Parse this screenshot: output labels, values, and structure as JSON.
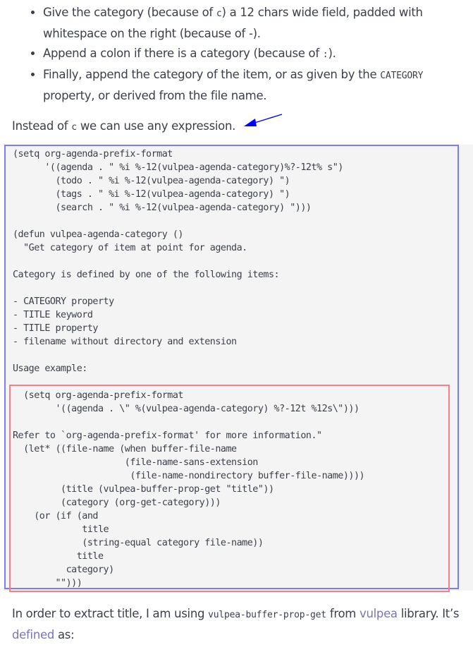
{
  "bullets": [
    {
      "before": "Give the category (because of ",
      "code": "c",
      "after": ") a 12 chars wide field, padded with whitespace on the right (because of -)."
    },
    {
      "before": "Append a colon if there is a category (because of ",
      "code": ":",
      "after": ")."
    },
    {
      "before": "Finally, append the category of the item, or as given by the ",
      "code": "CATEGORY",
      "after": " property, or derived from the file name."
    }
  ],
  "para1": {
    "before": "Instead of ",
    "code": "c",
    "after": " we can use any expression."
  },
  "annotation": {
    "arrow_color": "#0000ff",
    "outer_box_color": "#7b7bff",
    "inner_box_color": "#ff7b86"
  },
  "code_block": {
    "lines": [
      "(setq org-agenda-prefix-format",
      "      '((agenda . \" %i %-12(vulpea-agenda-category)%?-12t% s\")",
      "        (todo . \" %i %-12(vulpea-agenda-category) \")",
      "        (tags . \" %i %-12(vulpea-agenda-category) \")",
      "        (search . \" %i %-12(vulpea-agenda-category) \")))",
      "",
      "(defun vulpea-agenda-category ()",
      "  \"Get category of item at point for agenda.",
      "",
      "Category is defined by one of the following items:",
      "",
      "- CATEGORY property",
      "- TITLE keyword",
      "- TITLE property",
      "- filename without directory and extension",
      "",
      "Usage example:",
      "",
      "  (setq org-agenda-prefix-format",
      "        '((agenda . \\\" %(vulpea-agenda-category) %?-12t %12s\\\")))",
      "",
      "Refer to `org-agenda-prefix-format' for more information.\"",
      "  (let* ((file-name (when buffer-file-name",
      "                     (file-name-sans-extension",
      "                      (file-name-nondirectory buffer-file-name))))",
      "         (title (vulpea-buffer-prop-get \"title\"))",
      "         (category (org-get-category)))",
      "    (or (if (and",
      "             title",
      "             (string-equal category file-name))",
      "            title",
      "          category)",
      "        \"\")))"
    ]
  },
  "para2": {
    "before": "In order to extract title, I am using ",
    "code": "vulpea-buffer-prop-get",
    "middle": " from ",
    "link1": "vulpea",
    "middle2": " library. It’s ",
    "link2": "defined",
    "after": " as:"
  }
}
